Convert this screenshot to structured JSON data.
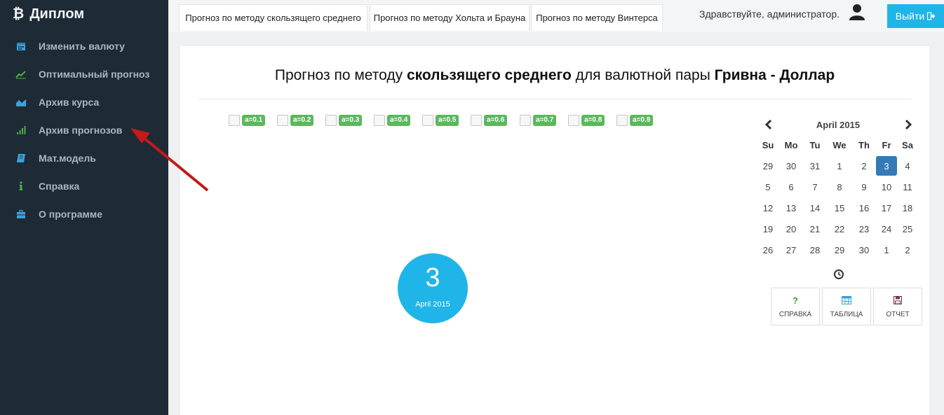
{
  "sidebar": {
    "brand": "Диплом",
    "items": [
      {
        "label": "Изменить валюту",
        "icon": "calendar-icon"
      },
      {
        "label": "Оптимальный прогноз",
        "icon": "line-chart-icon"
      },
      {
        "label": "Архив курса",
        "icon": "area-chart-icon"
      },
      {
        "label": "Архив прогнозов",
        "icon": "signal-bars-icon"
      },
      {
        "label": "Мат.модель",
        "icon": "book-icon"
      },
      {
        "label": "Справка",
        "icon": "info-icon"
      },
      {
        "label": "О программе",
        "icon": "briefcase-icon"
      }
    ]
  },
  "topbar": {
    "tabs": [
      "Прогноз по методу скользящего среднего",
      "Прогноз по методу Хольта и Брауна",
      "Прогноз по методу Винтерса"
    ],
    "greeting": "Здравствуйте, администратор.",
    "logout_label": "Выйти"
  },
  "main": {
    "title_part1": "Прогноз по методу ",
    "title_bold1": "скользящего среднего",
    "title_part2": " для валютной пары ",
    "title_bold2": "Гривна",
    "title_sep": " - ",
    "title_bold3": "Доллар",
    "alpha_options": [
      "a=0.1",
      "a=0.2",
      "a=0.3",
      "a=0.4",
      "a=0.5",
      "a=0.6",
      "a=0.7",
      "a=0.8",
      "a=0.9"
    ],
    "date_circle": {
      "day": "3",
      "month": "April 2015"
    }
  },
  "calendar": {
    "title": "April 2015",
    "weekdays": [
      "Su",
      "Mo",
      "Tu",
      "We",
      "Th",
      "Fr",
      "Sa"
    ],
    "weeks": [
      [
        "29",
        "30",
        "31",
        "1",
        "2",
        "3",
        "4"
      ],
      [
        "5",
        "6",
        "7",
        "8",
        "9",
        "10",
        "11"
      ],
      [
        "12",
        "13",
        "14",
        "15",
        "16",
        "17",
        "18"
      ],
      [
        "19",
        "20",
        "21",
        "22",
        "23",
        "24",
        "25"
      ],
      [
        "26",
        "27",
        "28",
        "29",
        "30",
        "1",
        "2"
      ]
    ],
    "selected": "3"
  },
  "actions": [
    {
      "label": "СПРАВКА",
      "icon": "question-icon"
    },
    {
      "label": "ТАБЛИЦА",
      "icon": "table-icon"
    },
    {
      "label": "ОТЧЕТ",
      "icon": "save-icon"
    }
  ],
  "colors": {
    "sidebar_bg": "#1e2a36",
    "accent": "#1fb5e8",
    "badge_green": "#5cb85c",
    "selected_day": "#337ab7",
    "arrow": "#c41a1a"
  }
}
